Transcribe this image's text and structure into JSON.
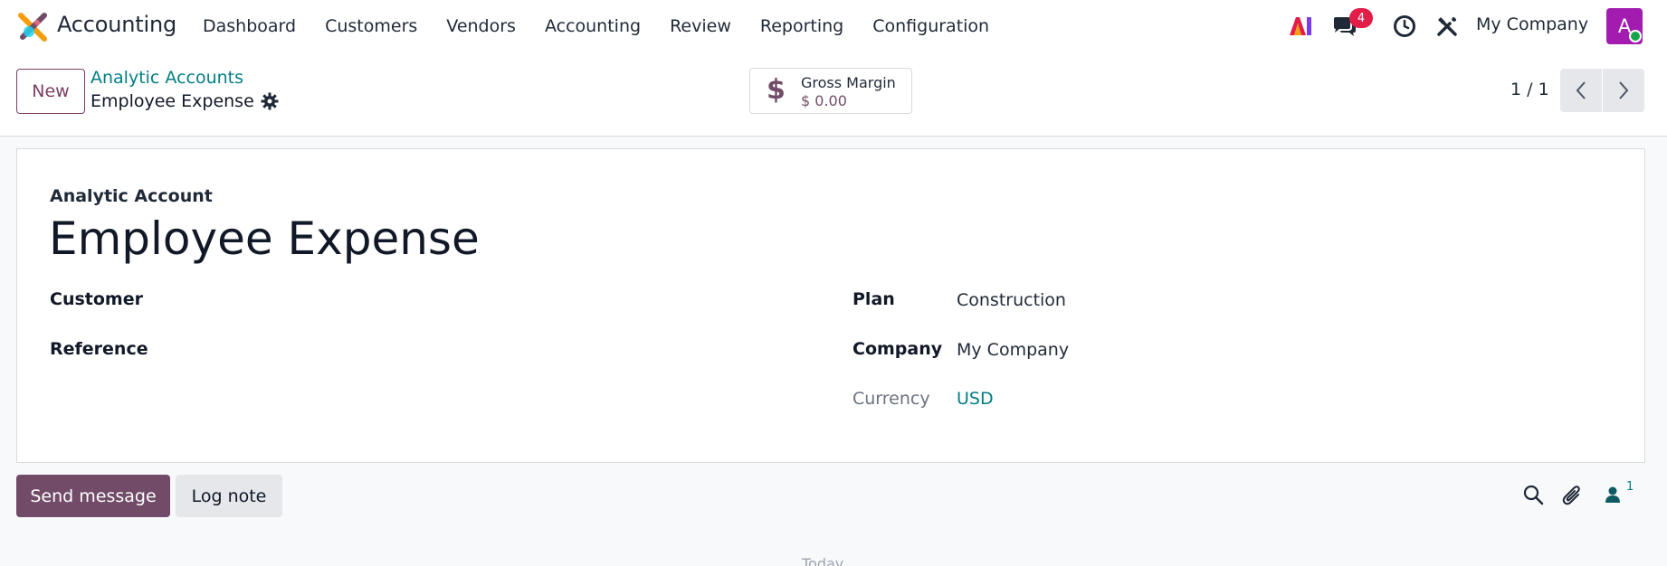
{
  "navbar": {
    "app_name": "Accounting",
    "menu": [
      "Dashboard",
      "Customers",
      "Vendors",
      "Accounting",
      "Review",
      "Reporting",
      "Configuration"
    ],
    "messages_badge": "4",
    "company": "My Company",
    "avatar_initial": "A"
  },
  "control_panel": {
    "new_label": "New",
    "breadcrumb_parent": "Analytic Accounts",
    "breadcrumb_current": "Employee Expense",
    "stat_label": "Gross Margin",
    "stat_value": "$ 0.00",
    "stat_icon": "dollar-icon",
    "pager": "1 / 1"
  },
  "form": {
    "sub_title": "Analytic Account",
    "title": "Employee Expense",
    "left_fields": {
      "customer_label": "Customer",
      "reference_label": "Reference"
    },
    "right_fields": {
      "plan_label": "Plan",
      "plan_value": "Construction",
      "company_label": "Company",
      "company_value": "My Company",
      "currency_label": "Currency",
      "currency_value": "USD"
    }
  },
  "chatter": {
    "send_message_label": "Send message",
    "log_note_label": "Log note",
    "followers_count": "1",
    "date_separator": "Today"
  },
  "colors": {
    "brand": "#714b67",
    "link": "#017e84",
    "badge": "#e11d48",
    "avatar": "#a21caf"
  }
}
